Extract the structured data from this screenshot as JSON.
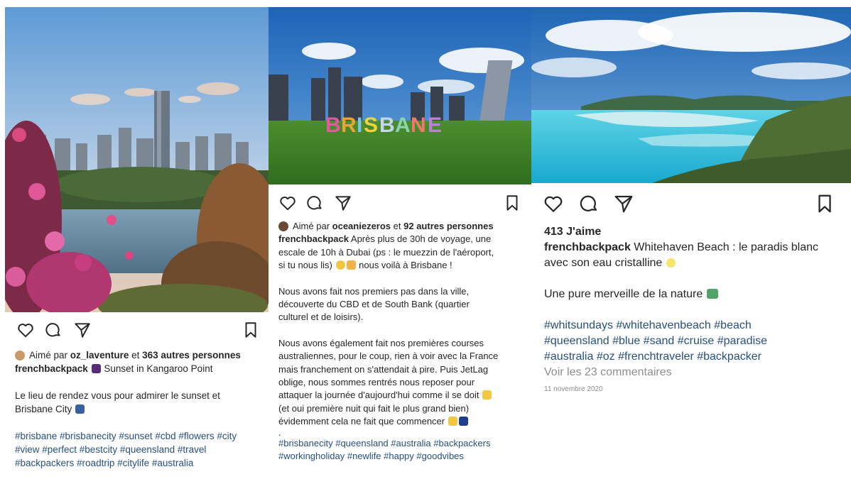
{
  "posts": [
    {
      "liked_by_prefix": "Aimé par",
      "liked_by_user": "oz_laventure",
      "liked_by_joiner": "et",
      "liked_by_others": "363 autres personnes",
      "username": "frenchbackpack",
      "caption": "Sunset in Kangaroo Point",
      "body": [
        "Le lieu de rendez vous pour admirer le sunset et",
        "Brisbane City"
      ],
      "hashtags": [
        "#brisbane #brisbanecity #sunset #cbd #flowers #city",
        "#view #perfect #bestcity #queensland #travel",
        "#backpackers #roadtrip #citylife #australia"
      ],
      "icons": [
        "heart-icon",
        "comment-icon",
        "share-icon",
        "bookmark-icon"
      ]
    },
    {
      "liked_by_prefix": "Aimé par",
      "liked_by_user": "oceaniezeros",
      "liked_by_joiner": "et",
      "liked_by_others": "92 autres personnes",
      "username": "frenchbackpack",
      "caption_lines": [
        "Après plus de 30h de voyage, une",
        "escale de 10h à Dubai (ps : le muezzin de l'aéroport,",
        "si tu nous lis)",
        "nous voilà à Brisbane !"
      ],
      "para2": [
        "Nous avons fait nos premiers pas dans la ville,",
        "découverte du CBD et de South Bank (quartier",
        "culturel et de loisirs)."
      ],
      "para3": [
        "Nous avons également fait nos premières courses",
        "australiennes, pour le coup, rien à voir avec la France",
        "mais franchement on s'attendait à pire. Puis JetLag",
        "oblige, nous sommes rentrés nous reposer pour",
        "attaquer la journée d'aujourd'hui comme il se doit",
        "(et oui première nuit qui fait le plus grand bien)",
        "évidemment cela ne fait que commencer"
      ],
      "dot": ".",
      "hashtags": [
        "#brisbanecity #queensland #australia #backpackers",
        "#workingholiday #newlife #happy #goodvibes"
      ],
      "sign_text": "BRISBANE"
    },
    {
      "likes": "413 J'aime",
      "username": "frenchbackpack",
      "caption_lines": [
        "Whitehaven Beach : le paradis blanc",
        "avec son eau cristalline"
      ],
      "para2": "Une pure merveille de la nature",
      "hashtags": [
        "#whitsundays #whitehavenbeach #beach",
        "#queensland #blue #sand #cruise #paradise",
        "#australia #oz #frenchtraveler #backpacker"
      ],
      "comments": "Voir les 23 commentaires",
      "date": "11 novembre 2020"
    }
  ],
  "colors": {
    "hashtag": "#27507f",
    "muted": "#8e8e8e",
    "text": "#262626"
  }
}
